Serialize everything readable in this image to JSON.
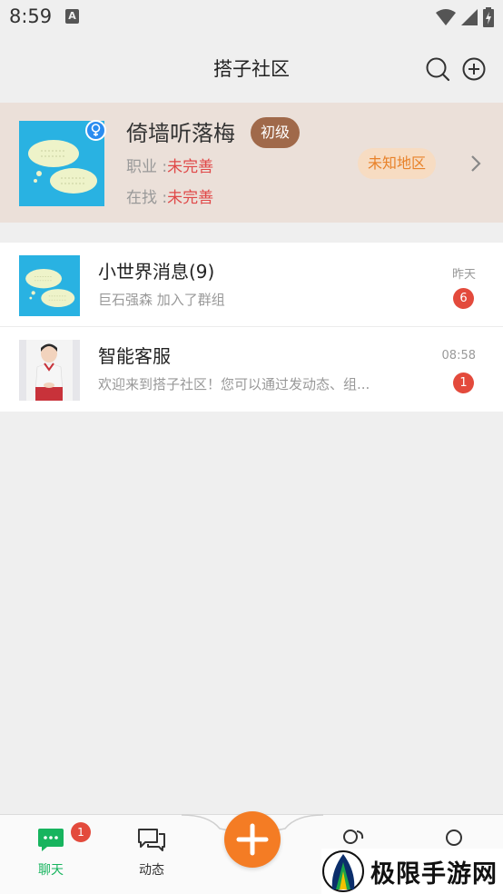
{
  "status_bar": {
    "time": "8:59",
    "a_icon": "A"
  },
  "header": {
    "title": "搭子社区"
  },
  "profile": {
    "name": "倚墙听落梅",
    "level": "初级",
    "job_label": "职业 :",
    "job_value": "未完善",
    "seeking_label": "在找 :",
    "seeking_value": "未完善",
    "region": "未知地区"
  },
  "chats": [
    {
      "name": "小世界消息(9)",
      "preview": "巨石强森 加入了群组",
      "time": "昨天",
      "unread": "6"
    },
    {
      "name": "智能客服",
      "preview": "欢迎来到搭子社区！您可以通过发动态、组...",
      "time": "08:58",
      "unread": "1"
    }
  ],
  "bottom_nav": {
    "chat_label": "聊天",
    "chat_badge": "1",
    "feed_label": "动态"
  },
  "watermark": {
    "text": "极限手游网"
  },
  "colors": {
    "accent_green": "#17b45e",
    "accent_orange": "#f47c24",
    "badge_red": "#e34a3c",
    "profile_bg": "#ebe0d9",
    "level_brown": "#a0694a"
  }
}
